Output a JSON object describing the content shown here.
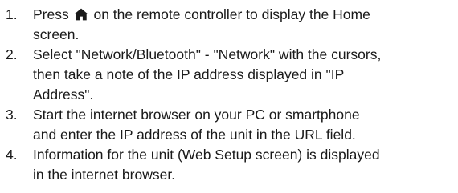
{
  "instructions": {
    "steps": [
      {
        "number": "1.",
        "text_before_icon": "Press",
        "icon": "home-icon",
        "text_after_icon": "on the remote controller to display the Home\nscreen."
      },
      {
        "number": "2.",
        "text": "Select \"Network/Bluetooth\" - \"Network\" with the cursors,\nthen take a note of the IP address displayed in \"IP\nAddress\"."
      },
      {
        "number": "3.",
        "text": "Start the internet browser on your PC or smartphone\nand enter the IP address of the unit in the URL field."
      },
      {
        "number": "4.",
        "text": "Information for the unit (Web Setup screen) is displayed\nin the internet browser."
      }
    ]
  }
}
